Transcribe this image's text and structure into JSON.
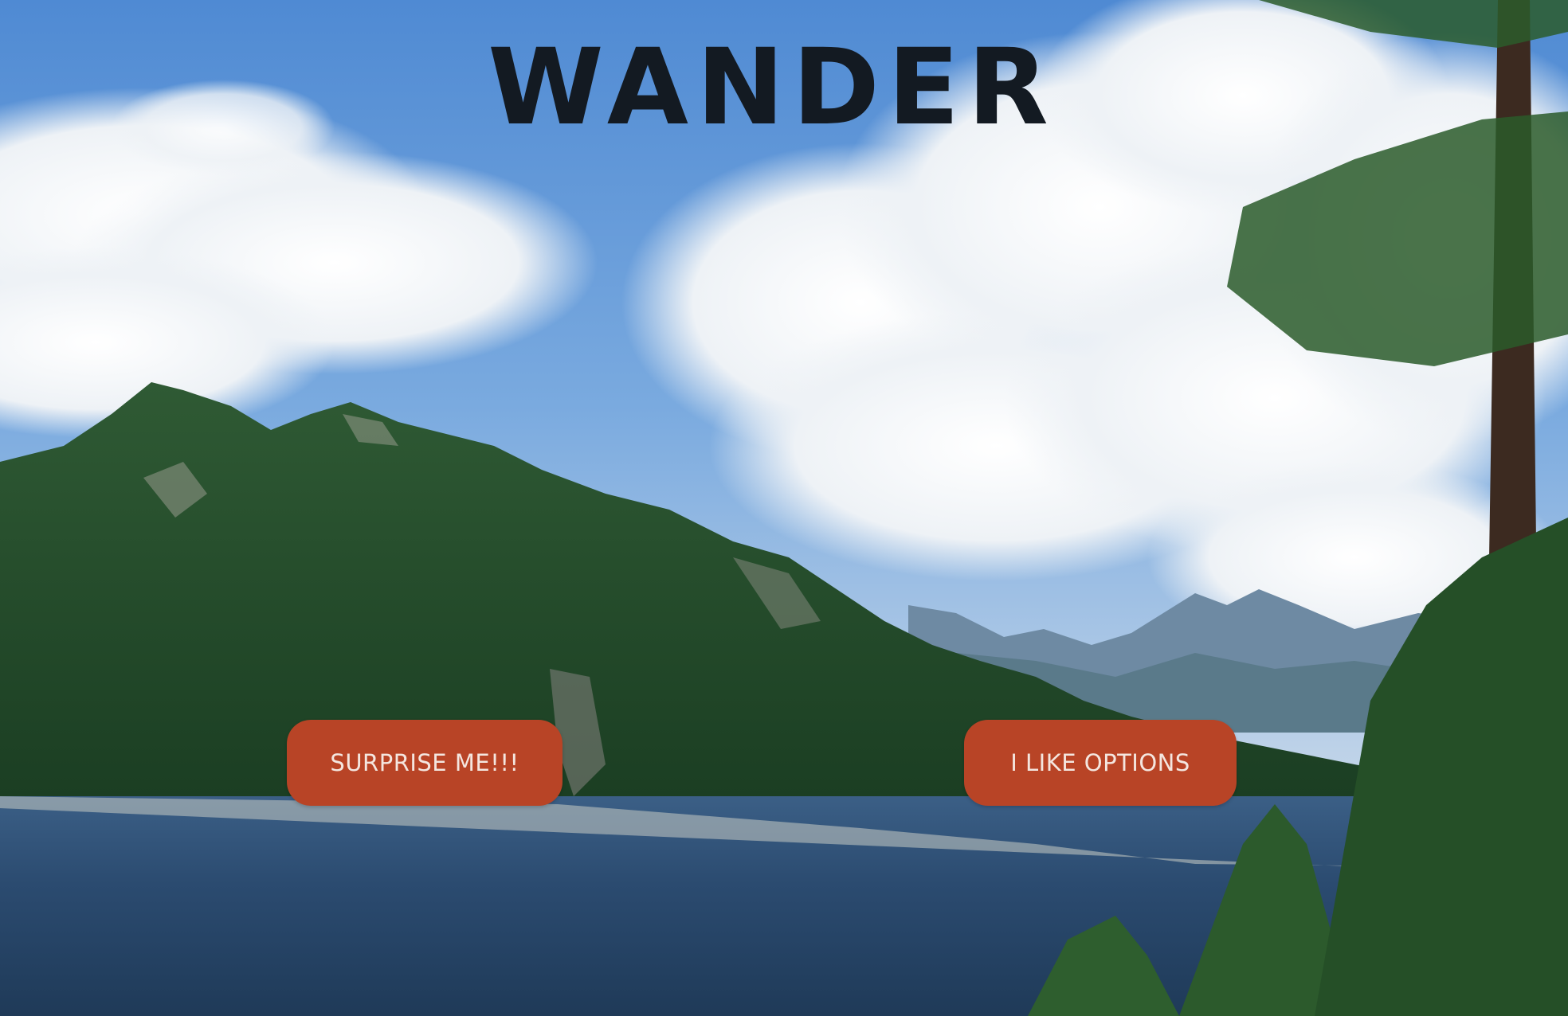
{
  "brand": {
    "logo_text": "WANDER"
  },
  "actions": {
    "surprise_label": "SURPRISE ME!!!",
    "options_label": "I LIKE OPTIONS"
  },
  "colors": {
    "logo": "#131a22",
    "button_bg": "#b84426",
    "button_text": "#f4e6df",
    "sky": "#5b95d6",
    "lake": "#2c4e72",
    "forest": "#1f4a2a"
  }
}
